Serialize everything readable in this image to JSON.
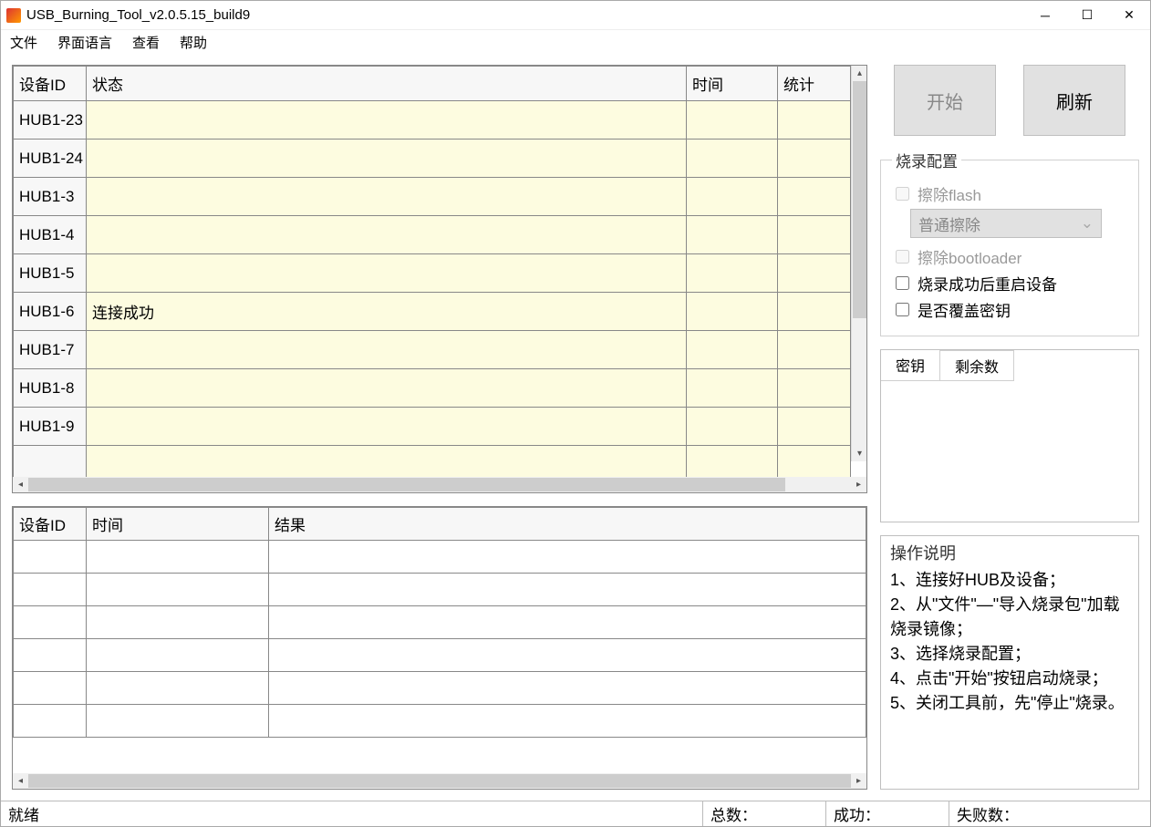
{
  "title": "USB_Burning_Tool_v2.0.5.15_build9",
  "menu": {
    "file": "文件",
    "lang": "界面语言",
    "view": "查看",
    "help": "帮助"
  },
  "table_top": {
    "headers": {
      "id": "设备ID",
      "status": "状态",
      "time": "时间",
      "stats": "统计"
    },
    "rows": [
      {
        "id": "HUB1-23",
        "status": "",
        "time": "",
        "stats": ""
      },
      {
        "id": "HUB1-24",
        "status": "",
        "time": "",
        "stats": ""
      },
      {
        "id": "HUB1-3",
        "status": "",
        "time": "",
        "stats": ""
      },
      {
        "id": "HUB1-4",
        "status": "",
        "time": "",
        "stats": ""
      },
      {
        "id": "HUB1-5",
        "status": "",
        "time": "",
        "stats": ""
      },
      {
        "id": "HUB1-6",
        "status": "连接成功",
        "time": "",
        "stats": ""
      },
      {
        "id": "HUB1-7",
        "status": "",
        "time": "",
        "stats": ""
      },
      {
        "id": "HUB1-8",
        "status": "",
        "time": "",
        "stats": ""
      },
      {
        "id": "HUB1-9",
        "status": "",
        "time": "",
        "stats": ""
      }
    ]
  },
  "table_bot": {
    "headers": {
      "id": "设备ID",
      "time": "时间",
      "result": "结果"
    }
  },
  "buttons": {
    "start": "开始",
    "refresh": "刷新"
  },
  "config": {
    "legend": "烧录配置",
    "erase_flash": "擦除flash",
    "erase_mode": "普通擦除",
    "erase_bootloader": "擦除bootloader",
    "reboot_after": "烧录成功后重启设备",
    "overwrite_key": "是否覆盖密钥"
  },
  "key_box": {
    "tab_key": "密钥",
    "tab_remain": "剩余数"
  },
  "instructions": {
    "title": "操作说明",
    "lines": [
      "1、连接好HUB及设备；",
      "2、从\"文件\"—\"导入烧录包\"加载烧录镜像；",
      "3、选择烧录配置；",
      "4、点击\"开始\"按钮启动烧录；",
      "5、关闭工具前，先\"停止\"烧录。"
    ]
  },
  "status": {
    "ready": "就绪",
    "total": "总数：",
    "success": "成功：",
    "fail": "失败数："
  }
}
